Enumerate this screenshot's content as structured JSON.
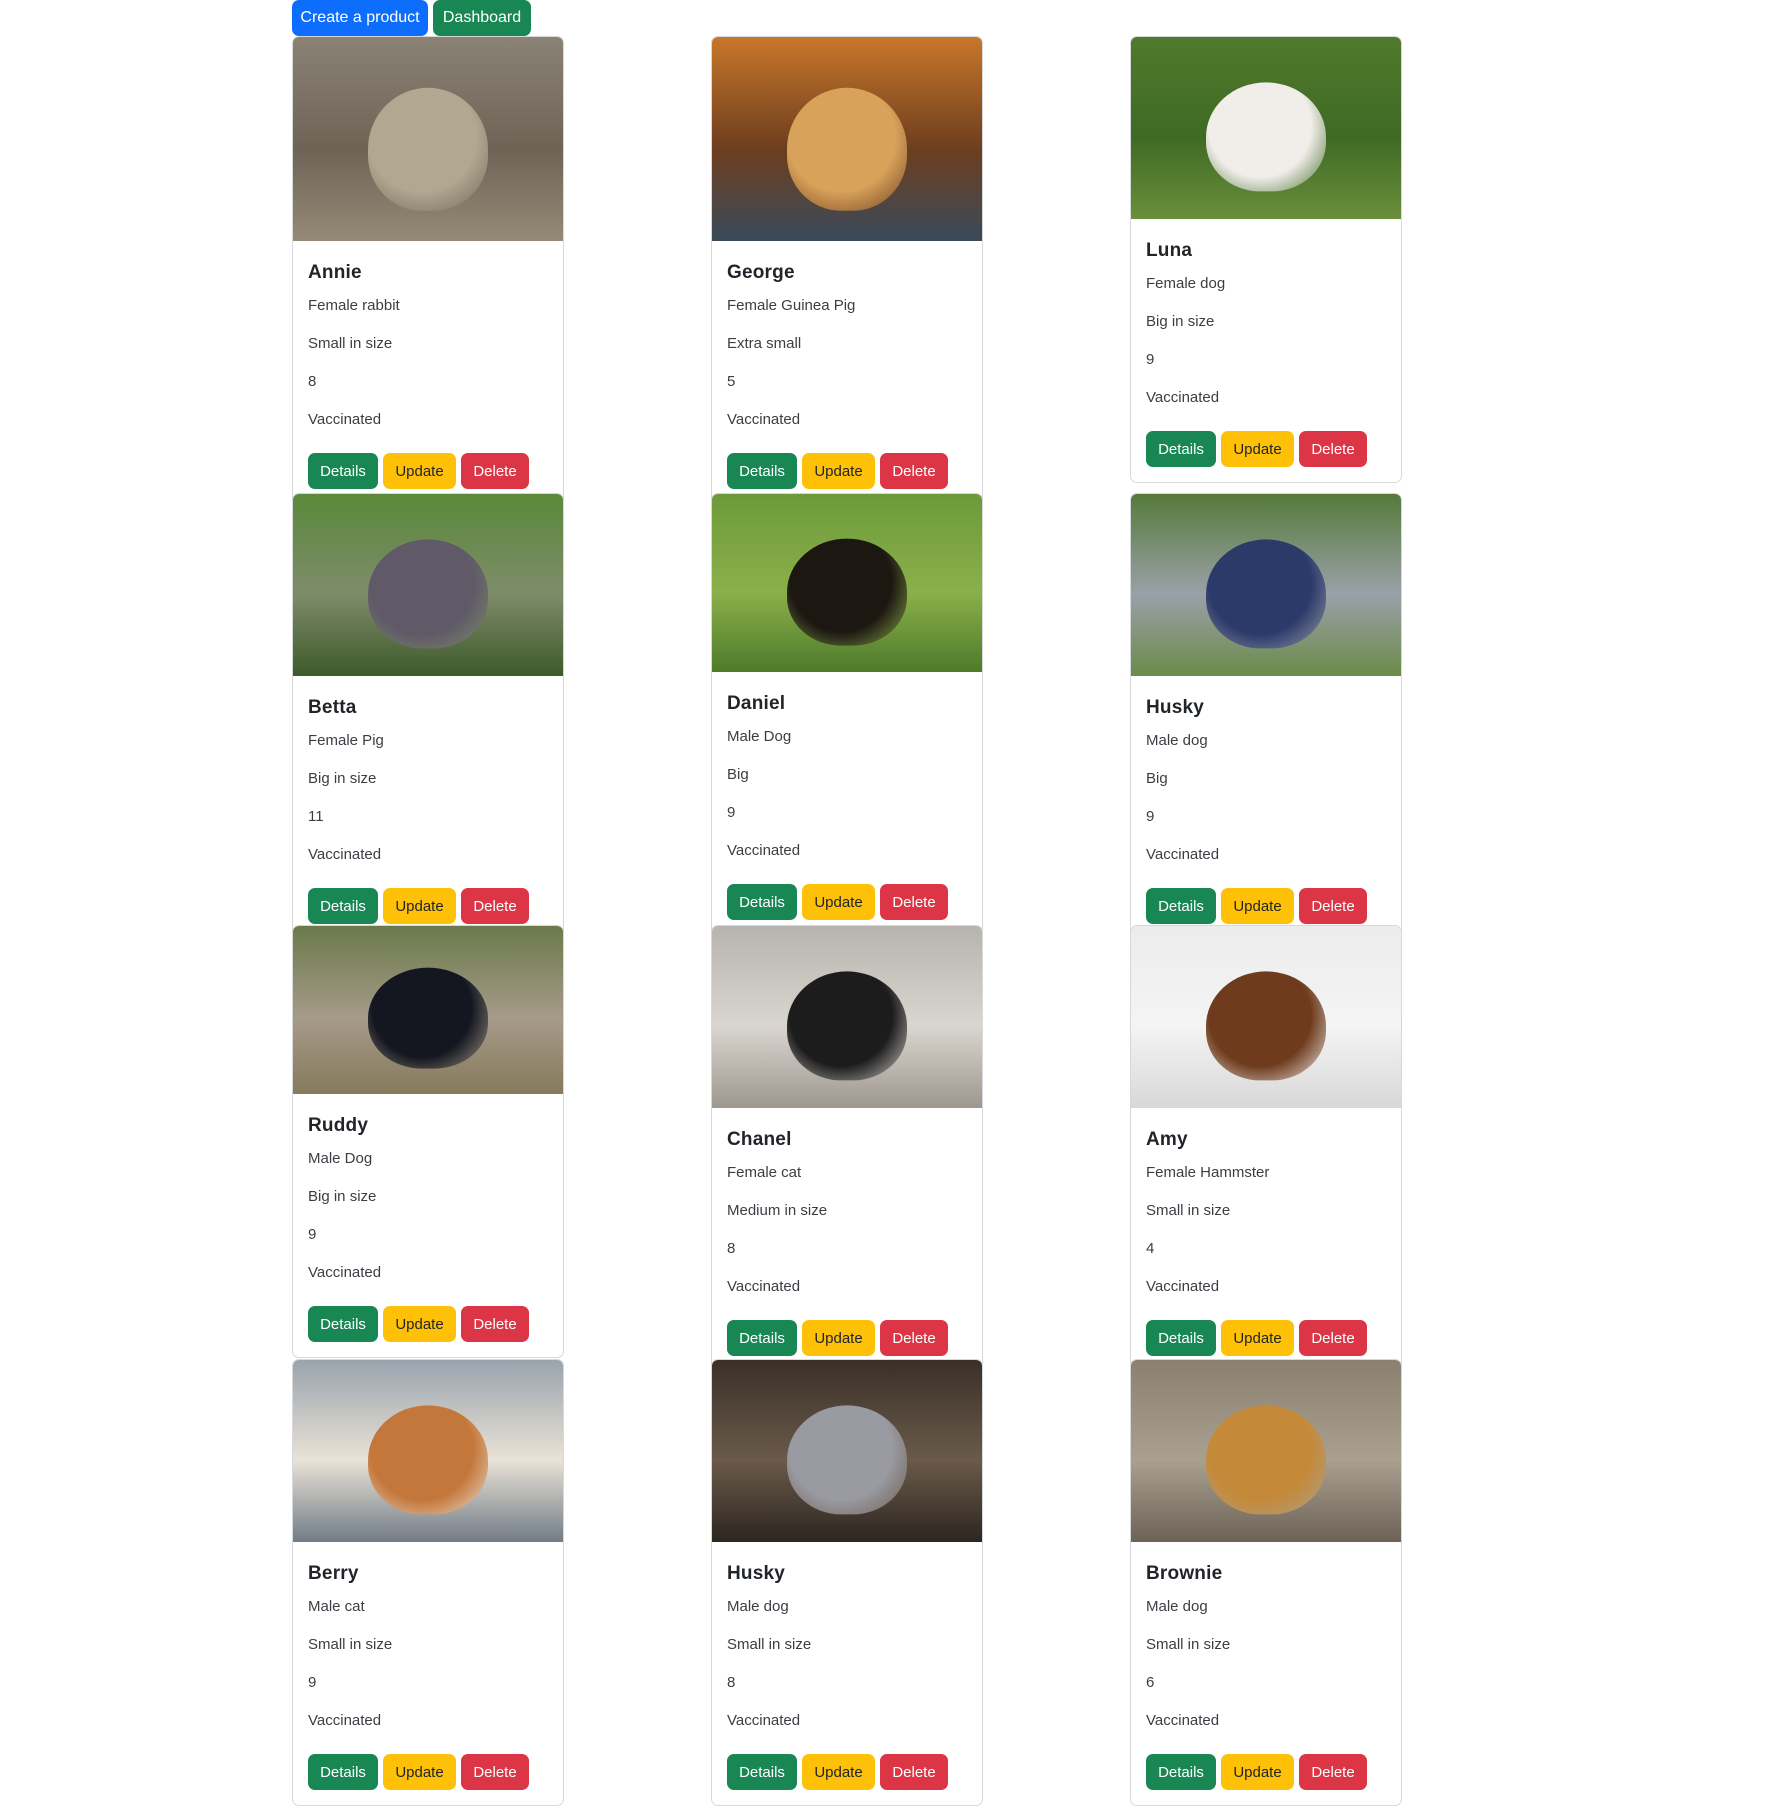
{
  "topbar": {
    "create_label": "Create a product",
    "dashboard_label": "Dashboard"
  },
  "buttons": {
    "details": "Details",
    "update": "Update",
    "delete": "Delete"
  },
  "pets": [
    {
      "name": "Annie",
      "gender_species": "Female rabbit",
      "size": "Small in size",
      "age": "8",
      "vaccination": "Vaccinated",
      "photo": "rabbit"
    },
    {
      "name": "George",
      "gender_species": "Female Guinea Pig",
      "size": "Extra small",
      "age": "5",
      "vaccination": "Vaccinated",
      "photo": "guinea pig"
    },
    {
      "name": "Luna",
      "gender_species": "Female dog",
      "size": "Big in size",
      "age": "9",
      "vaccination": "Vaccinated",
      "photo": "bulldog"
    },
    {
      "name": "Betta",
      "gender_species": "Female Pig",
      "size": "Big in size",
      "age": "11",
      "vaccination": "Vaccinated",
      "photo": "pig"
    },
    {
      "name": "Daniel",
      "gender_species": "Male Dog",
      "size": "Big",
      "age": "9",
      "vaccination": "Vaccinated",
      "photo": "doberman"
    },
    {
      "name": "Husky",
      "gender_species": "Male dog",
      "size": "Big",
      "age": "9",
      "vaccination": "Vaccinated",
      "photo": "husky"
    },
    {
      "name": "Ruddy",
      "gender_species": "Male Dog",
      "size": "Big in size",
      "age": "9",
      "vaccination": "Vaccinated",
      "photo": "rottweiler"
    },
    {
      "name": "Chanel",
      "gender_species": "Female cat",
      "size": "Medium in size",
      "age": "8",
      "vaccination": "Vaccinated",
      "photo": "cat"
    },
    {
      "name": "Amy",
      "gender_species": "Female Hammster",
      "size": "Small in size",
      "age": "4",
      "vaccination": "Vaccinated",
      "photo": "guinea pig"
    },
    {
      "name": "Berry",
      "gender_species": "Male cat",
      "size": "Small in size",
      "age": "9",
      "vaccination": "Vaccinated",
      "photo": "cats"
    },
    {
      "name": "Husky",
      "gender_species": "Male dog",
      "size": "Small in size",
      "age": "8",
      "vaccination": "Vaccinated",
      "photo": "yorkshire terrier"
    },
    {
      "name": "Brownie",
      "gender_species": "Male dog",
      "size": "Small in size",
      "age": "6",
      "vaccination": "Vaccinated",
      "photo": "puggle"
    }
  ]
}
